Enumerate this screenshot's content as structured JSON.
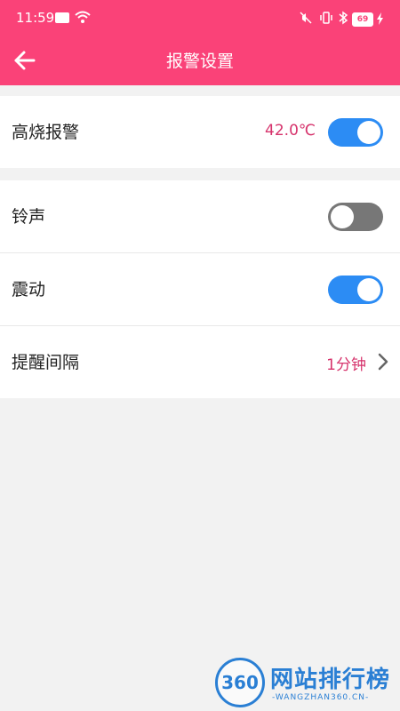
{
  "status_bar": {
    "time": "11:59",
    "battery": "69",
    "icons": [
      "notification-icon",
      "wifi-icon",
      "mute-icon",
      "vibrate-icon",
      "bluetooth-icon",
      "charging-icon"
    ]
  },
  "header": {
    "title": "报警设置",
    "back_icon": "arrow-left-icon"
  },
  "fever_alarm": {
    "label": "高烧报警",
    "value": "42.0℃",
    "enabled": true
  },
  "settings": [
    {
      "label": "铃声",
      "type": "toggle",
      "enabled": false
    },
    {
      "label": "震动",
      "type": "toggle",
      "enabled": true
    },
    {
      "label": "提醒间隔",
      "type": "select",
      "value": "1分钟"
    }
  ],
  "watermark": {
    "logo": "360",
    "text": "网站排行榜",
    "sub": "-WANGZHAN360.CN-"
  },
  "colors": {
    "header": "#fa4278",
    "accent_text": "#d6336c",
    "toggle_on": "#2c8cf4",
    "toggle_off": "#777777",
    "background": "#f2f2f2"
  }
}
